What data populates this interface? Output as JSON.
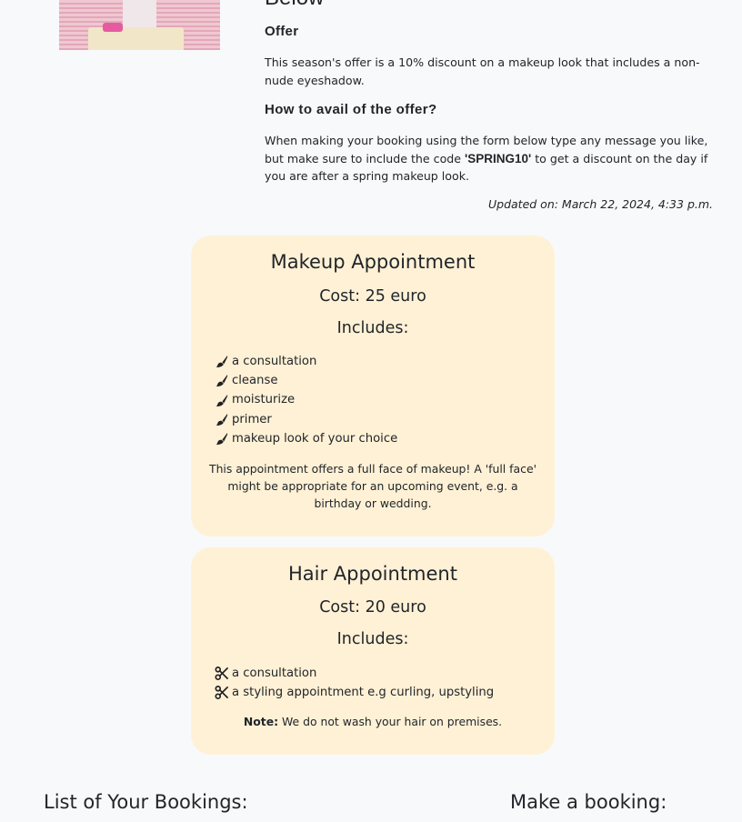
{
  "offer_section": {
    "truncated_heading": "Below",
    "offer_heading": "Offer",
    "offer_text": "This season's offer is a 10% discount on a makeup look that includes a non-nude eyeshadow.",
    "avail_heading": "How to avail of the offer?",
    "avail_text_before": "When making your booking using the form below type any message you like, but make sure to include the code ",
    "avail_code": "'SPRING10'",
    "avail_text_after": " to get a discount on the day if you are after a spring makeup look.",
    "updated": "Updated on: March 22, 2024, 4:33 p.m."
  },
  "makeup_card": {
    "title": "Makeup Appointment",
    "cost": "Cost: 25 euro",
    "includes_heading": "Includes:",
    "icon": "makeup-brush-icon",
    "items": [
      "a consultation",
      "cleanse",
      "moisturize",
      "primer",
      "makeup look of your choice"
    ],
    "description": "This appointment offers a full face of makeup! A 'full face' might be appropriate for an upcoming event, e.g. a birthday or wedding."
  },
  "hair_card": {
    "title": "Hair Appointment",
    "cost": "Cost: 20 euro",
    "includes_heading": "Includes:",
    "icon": "scissors-icon",
    "items": [
      "a consultation",
      "a styling appointment e.g curling, upstyling"
    ],
    "note_label": "Note:",
    "note_text": " We do not wash your hair on premises."
  },
  "bookings_heading": "List of Your Bookings:",
  "make_booking_heading": "Make a booking:",
  "colors": {
    "card_background": "#fff1d6",
    "page_background": "#f8f9fb",
    "text": "#212529"
  }
}
